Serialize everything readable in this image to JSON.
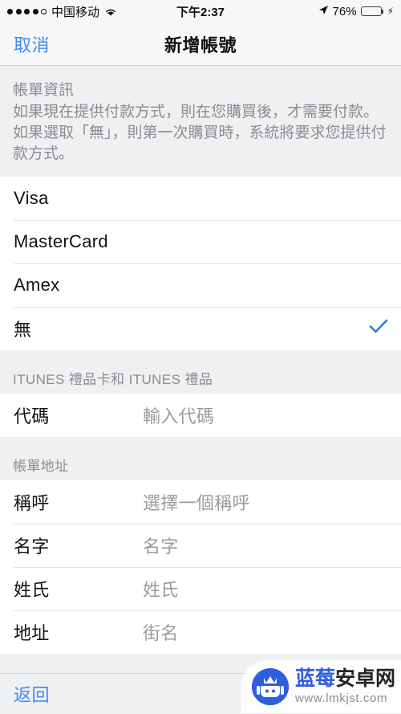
{
  "status_bar": {
    "signal_dots_filled": 4,
    "signal_dots_total": 5,
    "carrier": "中国移动",
    "wifi_icon": "wifi-icon",
    "time": "下午2:37",
    "location_icon": "location-arrow-icon",
    "battery_percent": "76%",
    "battery_level": 76,
    "charging_icon": "lightning-bolt-icon"
  },
  "nav_bar": {
    "cancel_label": "取消",
    "title": "新增帳號"
  },
  "billing_info": {
    "header": "帳單資訊",
    "description": "如果現在提供付款方式，則在您購買後，才需要付款。 如果選取「無」，則第一次購買時，系統將要求您提供付款方式。",
    "options": [
      {
        "label": "Visa",
        "selected": false
      },
      {
        "label": "MasterCard",
        "selected": false
      },
      {
        "label": "Amex",
        "selected": false
      },
      {
        "label": "無",
        "selected": true
      }
    ],
    "checkmark_icon": "checkmark-icon"
  },
  "gift_card": {
    "header": "ITUNES 禮品卡和 ITUNES 禮品",
    "code_label": "代碼",
    "code_placeholder": "輸入代碼"
  },
  "billing_address": {
    "header": "帳單地址",
    "fields": [
      {
        "label": "稱呼",
        "placeholder": "選擇一個稱呼"
      },
      {
        "label": "名字",
        "placeholder": "名字"
      },
      {
        "label": "姓氏",
        "placeholder": "姓氏"
      },
      {
        "label": "地址",
        "placeholder": "街名"
      }
    ]
  },
  "toolbar": {
    "back_label": "返回"
  },
  "watermark": {
    "logo_icon": "android-robot-icon",
    "title_part1": "蓝莓",
    "title_part2": "安卓网",
    "url": "www.lmkjst.com"
  },
  "colors": {
    "accent_blue": "#3e8bf7",
    "check_blue": "#2f7ce0",
    "battery_green": "#4cd964",
    "group_bg": "#ffffff",
    "page_bg": "#eff0f2",
    "secondary_text": "#8c8c91",
    "placeholder_text": "#9b9b9f"
  }
}
